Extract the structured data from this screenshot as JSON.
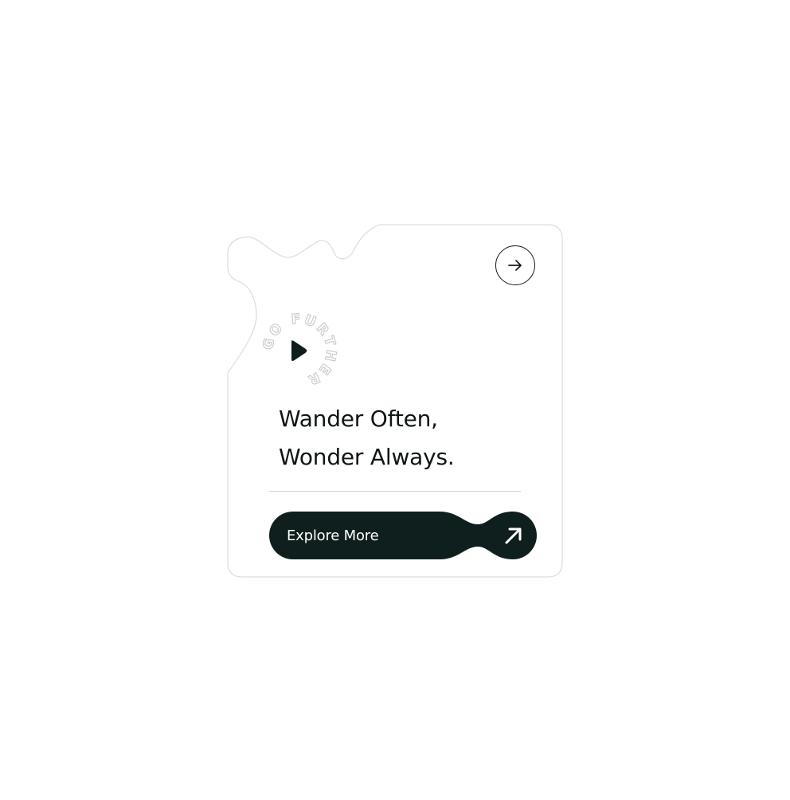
{
  "card": {
    "headline_line1": "Wander Often,",
    "headline_line2": "Wonder Always.",
    "badge_text": "GO FURTHER",
    "cta_label": "Explore More"
  },
  "icons": {
    "top_button": "arrow-right-icon",
    "badge": "play-icon",
    "cta": "arrow-up-right-icon"
  },
  "colors": {
    "accent_dark": "#0f1f1d",
    "text": "#101515",
    "card_bg": "#ffffff",
    "card_border": "#dcdcdc",
    "divider": "#cfcfcf"
  }
}
